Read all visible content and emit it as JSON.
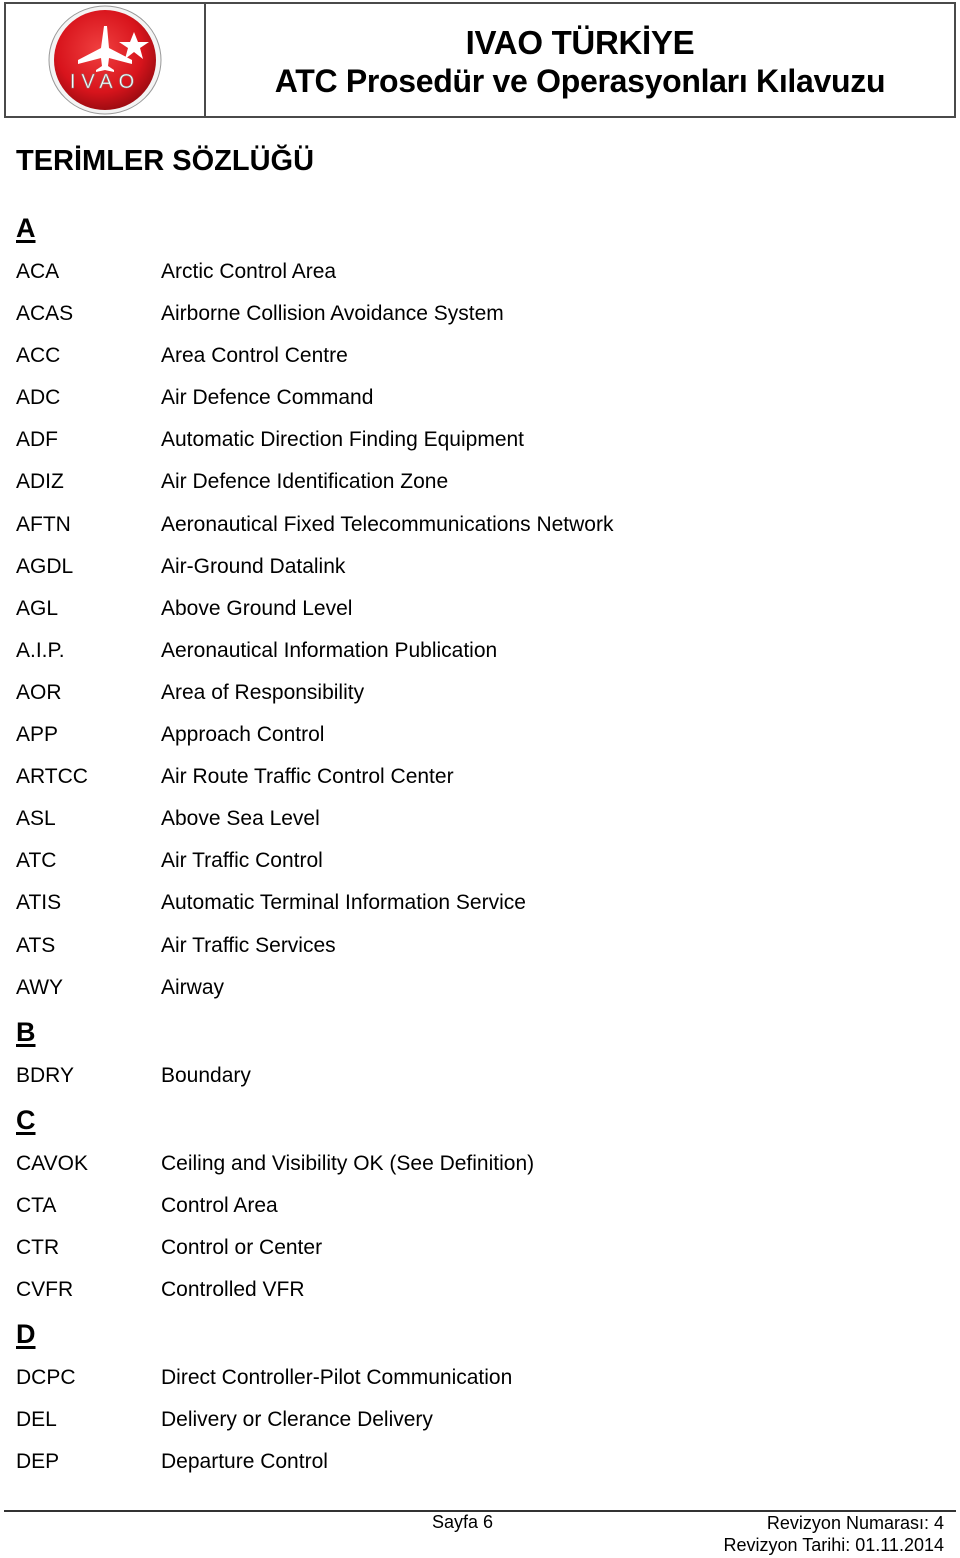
{
  "header": {
    "logo_text": "IVAO",
    "title_line1": "IVAO TÜRKİYE",
    "title_line2": "ATC Prosedür ve Operasyonları Kılavuzu"
  },
  "page_title": "TERİMLER SÖZLÜĞÜ",
  "sections": [
    {
      "letter": "A",
      "terms": [
        {
          "abbr": "ACA",
          "def": "Arctic Control Area"
        },
        {
          "abbr": "ACAS",
          "def": "Airborne Collision Avoidance System"
        },
        {
          "abbr": "ACC",
          "def": "Area Control Centre"
        },
        {
          "abbr": "ADC",
          "def": "Air Defence Command"
        },
        {
          "abbr": "ADF",
          "def": "Automatic Direction Finding Equipment"
        },
        {
          "abbr": "ADIZ",
          "def": "Air Defence Identification Zone"
        },
        {
          "abbr": "AFTN",
          "def": "Aeronautical Fixed Telecommunications Network"
        },
        {
          "abbr": "AGDL",
          "def": "Air-Ground Datalink"
        },
        {
          "abbr": "AGL",
          "def": "Above Ground Level"
        },
        {
          "abbr": "A.I.P.",
          "def": "Aeronautical Information Publication"
        },
        {
          "abbr": "AOR",
          "def": "Area of Responsibility"
        },
        {
          "abbr": "APP",
          "def": "Approach Control"
        },
        {
          "abbr": "ARTCC",
          "def": "Air Route Traffic Control Center"
        },
        {
          "abbr": "ASL",
          "def": "Above Sea Level"
        },
        {
          "abbr": "ATC",
          "def": "Air Traffic Control"
        },
        {
          "abbr": "ATIS",
          "def": "Automatic Terminal Information Service"
        },
        {
          "abbr": "ATS",
          "def": "Air Traffic Services"
        },
        {
          "abbr": "AWY",
          "def": "Airway"
        }
      ]
    },
    {
      "letter": "B",
      "terms": [
        {
          "abbr": "BDRY",
          "def": "Boundary"
        }
      ]
    },
    {
      "letter": "C",
      "terms": [
        {
          "abbr": "CAVOK",
          "def": "Ceiling and Visibility OK (See Definition)"
        },
        {
          "abbr": "CTA",
          "def": "Control Area"
        },
        {
          "abbr": "CTR",
          "def": "Control or Center"
        },
        {
          "abbr": "CVFR",
          "def": "Controlled VFR"
        }
      ]
    },
    {
      "letter": "D",
      "terms": [
        {
          "abbr": "DCPC",
          "def": "Direct Controller-Pilot Communication"
        },
        {
          "abbr": "DEL",
          "def": "Delivery or Clerance Delivery"
        },
        {
          "abbr": "DEP",
          "def": "Departure Control"
        }
      ]
    }
  ],
  "footer": {
    "page": "Sayfa 6",
    "revision_number": "Revizyon Numarası: 4",
    "revision_date": "Revizyon Tarihi: 01.11.2014"
  },
  "colors": {
    "logo_red": "#d8141c",
    "border": "#4a4a4a"
  }
}
